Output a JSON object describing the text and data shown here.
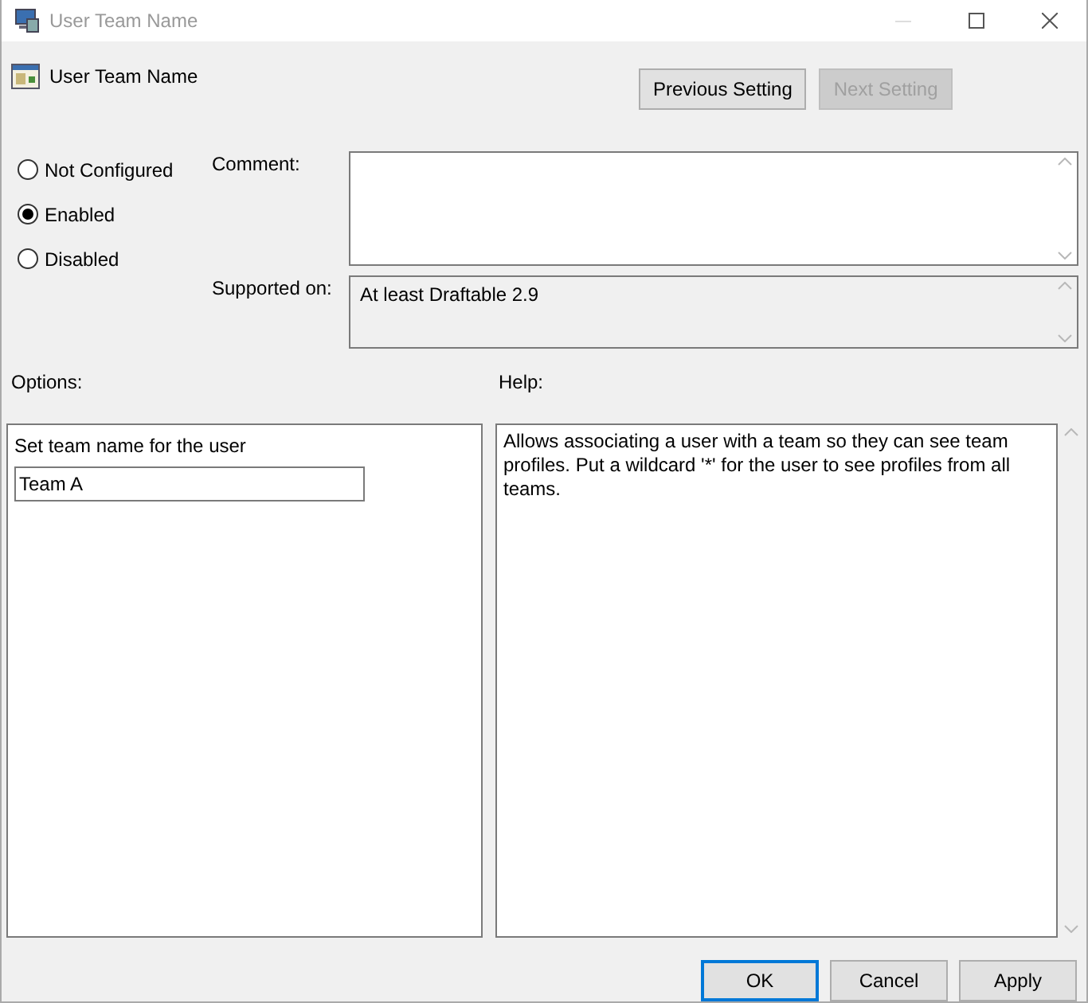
{
  "window": {
    "title": "User Team Name"
  },
  "heading": "User Team Name",
  "nav_buttons": [
    {
      "label": "Previous Setting",
      "disabled": false
    },
    {
      "label": "Next Setting",
      "disabled": true
    }
  ],
  "state_options": [
    {
      "label": "Not Configured",
      "selected": false
    },
    {
      "label": "Enabled",
      "selected": true
    },
    {
      "label": "Disabled",
      "selected": false
    }
  ],
  "comment": {
    "label": "Comment:"
  },
  "supported_on": {
    "label": "Supported on:",
    "value": "At least Draftable 2.9"
  },
  "options": {
    "label": "Options:",
    "items": [
      {
        "kind": "text",
        "text": "Set team name for the user"
      },
      {
        "kind": "textbox",
        "value": "Team A"
      }
    ]
  },
  "help": {
    "label": "Help:",
    "text": "Allows associating a user with a team so they can see team profiles. Put a wildcard '*' for the user to see profiles from all teams."
  },
  "buttons": [
    {
      "label": "OK",
      "default": true
    },
    {
      "label": "Cancel",
      "default": false
    },
    {
      "label": "Apply",
      "default": false
    }
  ]
}
